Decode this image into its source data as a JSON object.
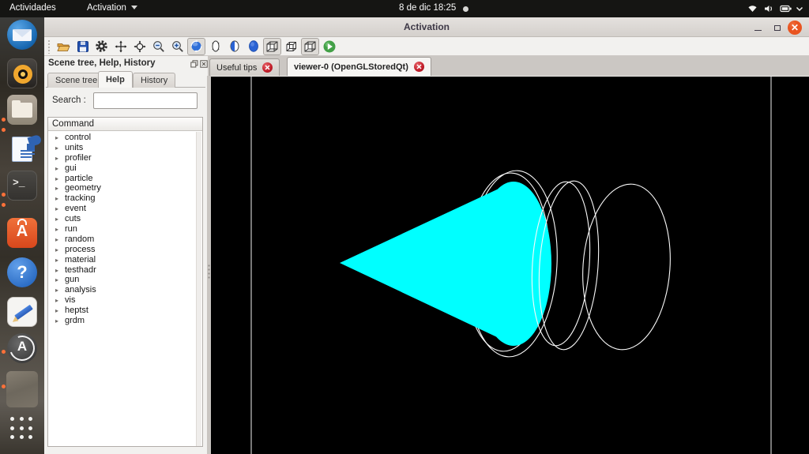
{
  "top_bar": {
    "activities": "Actividades",
    "app_menu": "Activation",
    "clock": "8 de dic 18:25",
    "status_icons": [
      "recording-dot",
      "wifi-icon",
      "volume-icon",
      "battery-icon",
      "chevron-down-icon"
    ]
  },
  "dock": {
    "items": [
      {
        "name": "thunderbird-icon",
        "indicators": 0
      },
      {
        "name": "rhythmbox-icon",
        "indicators": 0
      },
      {
        "name": "files-icon",
        "indicators": 2
      },
      {
        "name": "libreoffice-writer-icon",
        "indicators": 0
      },
      {
        "name": "terminal-icon",
        "indicators": 2
      },
      {
        "name": "ubuntu-software-icon",
        "indicators": 0
      },
      {
        "name": "help-icon",
        "indicators": 0
      },
      {
        "name": "text-editor-icon",
        "indicators": 0
      },
      {
        "name": "activation-app-icon",
        "indicators": 1
      },
      {
        "name": "screenshot-thumbnail",
        "indicators": 1
      },
      {
        "name": "show-applications-icon",
        "indicators": 0
      }
    ],
    "terminal_prompt": ">_",
    "software_letter": "A",
    "help_glyph": "?",
    "activation_letter": "A"
  },
  "window": {
    "title": "Activation",
    "controls": [
      "minimize-button",
      "maximize-button",
      "close-button"
    ],
    "toolbar": {
      "buttons": [
        {
          "name": "open-file-button",
          "icon": "folder-open-icon",
          "pressed": false
        },
        {
          "name": "save-button",
          "icon": "floppy-disk-icon",
          "pressed": false
        },
        {
          "name": "settings-button",
          "icon": "gear-icon",
          "pressed": false
        },
        {
          "name": "move-button",
          "icon": "move-arrows-icon",
          "pressed": false
        },
        {
          "name": "center-pick-button",
          "icon": "crosshair-icon",
          "pressed": false
        },
        {
          "name": "zoom-out-button",
          "icon": "magnifier-minus-icon",
          "pressed": false
        },
        {
          "name": "zoom-in-button",
          "icon": "magnifier-plus-icon",
          "pressed": false
        },
        {
          "name": "rotate-button",
          "icon": "rotate-sphere-icon",
          "pressed": true
        },
        {
          "name": "wireframe-style-button",
          "icon": "cylinder-wireframe-icon",
          "pressed": false
        },
        {
          "name": "hidden-line-style-button",
          "icon": "cylinder-halfsolid-icon",
          "pressed": false
        },
        {
          "name": "solid-style-button",
          "icon": "cylinder-solid-icon",
          "pressed": false
        },
        {
          "name": "projection-button-1",
          "icon": "cube-wireframe-icon",
          "pressed": true
        },
        {
          "name": "projection-button-2",
          "icon": "cube-wireframe-icon",
          "pressed": false
        },
        {
          "name": "projection-button-3",
          "icon": "cube-wireframe-icon",
          "pressed": true
        },
        {
          "name": "run-beam-button",
          "icon": "play-icon",
          "pressed": false
        }
      ]
    },
    "left_panel": {
      "dock_title": "Scene tree, Help, History",
      "dock_buttons": [
        "undock-icon",
        "close-icon"
      ],
      "tabs": [
        "Scene tree",
        "Help",
        "History"
      ],
      "active_tab": "Help",
      "search_label": "Search :",
      "search_value": "",
      "command_header": "Command",
      "tree": [
        "control",
        "units",
        "profiler",
        "gui",
        "particle",
        "geometry",
        "tracking",
        "event",
        "cuts",
        "run",
        "random",
        "process",
        "material",
        "testhadr",
        "gun",
        "analysis",
        "vis",
        "heptst",
        "grdm"
      ]
    },
    "viewer_tabs": [
      {
        "label": "Useful tips",
        "close_icon": "tab-close-icon",
        "active": false
      },
      {
        "label": "viewer-0 (OpenGLStoredQt)",
        "close_icon": "tab-close-icon",
        "active": true
      }
    ],
    "viewport": {
      "background": "#000000",
      "solid_color": "#00ffff",
      "wireframe_color": "#fafafa",
      "shapes": [
        "solid-cone-pointing-left",
        "wire-ring-around-cone",
        "wire-ring-middle",
        "wire-ring-right",
        "world-edge-line-left",
        "world-edge-line-right"
      ]
    }
  },
  "colors": {
    "accent_orange": "#e95420",
    "tab_close_red": "#c01c28",
    "toolbar_blue": "#2a63d4",
    "run_green": "#43a047"
  }
}
